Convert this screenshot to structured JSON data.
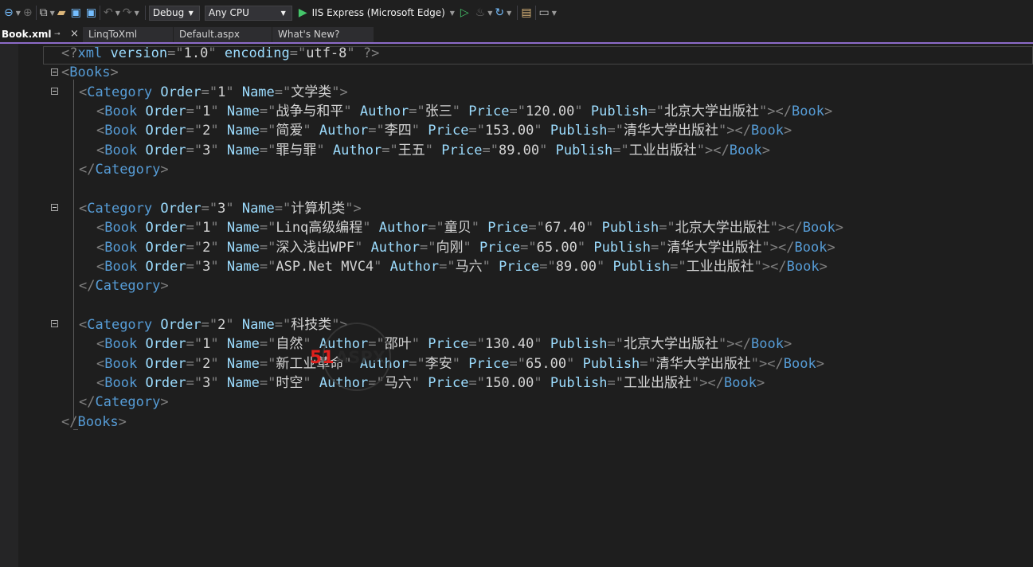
{
  "toolbar": {
    "config": "Debug",
    "platform": "Any CPU",
    "run_target": "IIS Express (Microsoft Edge)"
  },
  "tabs": [
    {
      "label": "Book.xml",
      "active": true
    },
    {
      "label": "LinqToXml",
      "active": false
    },
    {
      "label": "Default.aspx",
      "active": false
    },
    {
      "label": "What's New?",
      "active": false
    }
  ],
  "code": {
    "line1": "<?xml version=\"1.0\" encoding=\"utf-8\" ?>",
    "books_open": "<Books>",
    "books_close": "</Books>",
    "category_close": "</Category>",
    "categories": [
      {
        "open": "<Category Order=\"1\" Name=\"文学类\">",
        "books": [
          "<Book Order=\"1\" Name=\"战争与和平\" Author=\"张三\" Price=\"120.00\" Publish=\"北京大学出版社\"></Book>",
          "<Book Order=\"2\" Name=\"简爱\" Author=\"李四\" Price=\"153.00\" Publish=\"清华大学出版社\"></Book>",
          "<Book Order=\"3\" Name=\"罪与罪\" Author=\"王五\" Price=\"89.00\" Publish=\"工业出版社\"></Book>"
        ]
      },
      {
        "open": "<Category Order=\"3\" Name=\"计算机类\">",
        "books": [
          "<Book Order=\"1\" Name=\"Linq高级编程\" Author=\"童贝\" Price=\"67.40\" Publish=\"北京大学出版社\"></Book>",
          "<Book Order=\"2\" Name=\"深入浅出WPF\" Author=\"向刚\" Price=\"65.00\" Publish=\"清华大学出版社\"></Book>",
          "<Book Order=\"3\" Name=\"ASP.Net MVC4\" Author=\"马六\" Price=\"89.00\" Publish=\"工业出版社\"></Book>"
        ]
      },
      {
        "open": "<Category Order=\"2\" Name=\"科技类\">",
        "books": [
          "<Book Order=\"1\" Name=\"自然\" Author=\"邵叶\" Price=\"130.40\" Publish=\"北京大学出版社\"></Book>",
          "<Book Order=\"2\" Name=\"新工业革命\" Author=\"李安\" Price=\"65.00\" Publish=\"清华大学出版社\"></Book>",
          "<Book Order=\"3\" Name=\"时空\" Author=\"马六\" Price=\"150.00\" Publish=\"工业出版社\"></Book>"
        ]
      }
    ]
  },
  "watermark": {
    "text_red": "51",
    "text_dark": "ASPX"
  }
}
